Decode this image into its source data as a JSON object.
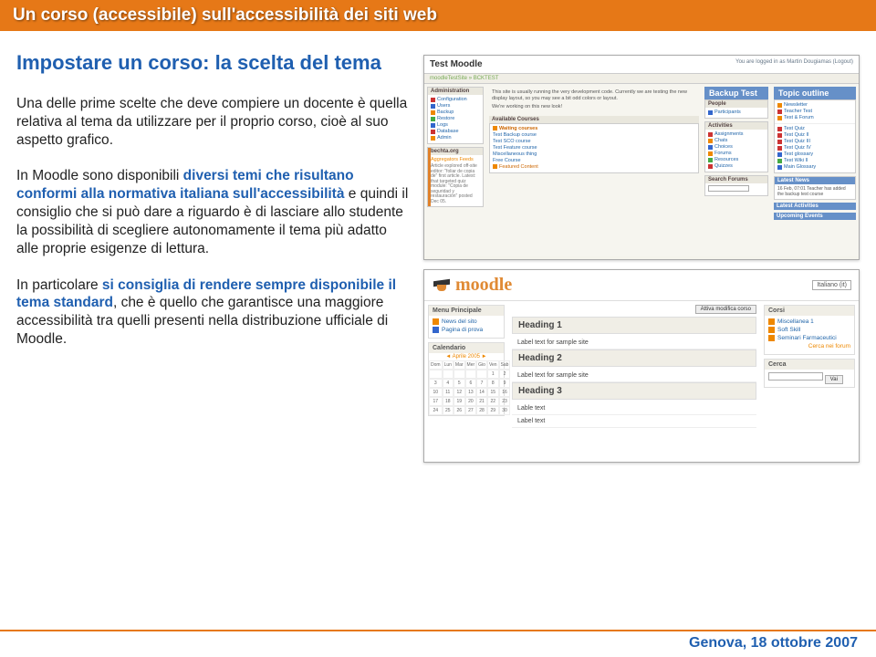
{
  "header": {
    "title": "Un corso (accessibile) sull'accessibilità dei siti web"
  },
  "slide": {
    "title": "Impostare un corso: la scelta del tema",
    "para1_pre": "Una delle prime scelte che deve compiere un docente è quella relativa al ",
    "para1_em1": "tema",
    "para1_mid": " da utilizzare per il proprio corso, cioè al suo ",
    "para1_em2": "aspetto grafico",
    "para1_end": ".",
    "para2_pre": "In Moodle sono disponibili ",
    "para2_b1": "diversi temi che risultano conformi alla normativa italiana sull'accessibilità",
    "para2_mid": " e quindi il consiglio che si può dare a riguardo è di lasciare allo studente la possibilità di scegliere autonomamente il tema più adatto alle proprie esigenze di lettura.",
    "para3_pre": "In particolare ",
    "para3_b1": "si consiglia di rendere sempre disponibile il tema standard",
    "para3_mid": ", che è quello che garantisce una maggiore accessibilità tra quelli presenti nella distribuzione ufficiale di Moodle."
  },
  "screenshots": {
    "top": {
      "title": "Test Moodle",
      "crumb": "moodleTestSite » BCKTEST",
      "admin_header": "Administration",
      "admin_items": [
        "Configuration",
        "Users",
        "Backup",
        "Restore",
        "Logs",
        "Database",
        "Admin"
      ],
      "bottom_left_header": "bechta.org",
      "bottom_left_sub": "Aggregators Feeds",
      "mid_text": "This site is usually running the very development code. Currently we are testing the new display layout, so you may see a bit odd colors or layout.",
      "mid_text2": "We're working on this new look!",
      "courses_header": "Available Courses",
      "waiting": "Waiting courses",
      "course_items": [
        "Test Backup course",
        "Test SCO course",
        "Test Feature course",
        "Miscellaneous thing",
        "Free Course",
        "Featured Content"
      ],
      "right_col1_header": "Backup Test",
      "people": "People",
      "people_item": "Participants",
      "activities": "Activities",
      "activity_items": [
        "Assignments",
        "Chats",
        "Choices",
        "Forums",
        "Resources",
        "Quizzes"
      ],
      "search": "Search Forums",
      "topic_header": "Topic outline",
      "topic_items": [
        "Newsletter",
        "Teacher Test",
        "Test & Forum"
      ],
      "topic_items2": [
        "Test Quiz",
        "Test Quiz II",
        "Test Quiz III",
        "Test Quiz IV",
        "Test glossary",
        "Test Wiki II",
        "Main Glossary"
      ],
      "latest": "Latest News",
      "latest_item": "16 Feb, 07:01 Teacher has added the backup test course",
      "latest2": "Latest Activities",
      "upcoming": "Upcoming Events",
      "login": "You are logged in as Martin Dougiamas (Logout)"
    },
    "bottom": {
      "logo": "moodle",
      "lang": "Italiano (it)",
      "menu_header": "Menu Principale",
      "menu_items": [
        "News del sito",
        "Pagina di prova"
      ],
      "cal_header": "Calendario",
      "cal_month": "Aprile 2005",
      "cal_dow": [
        "Dom",
        "Lun",
        "Mar",
        "Mer",
        "Gio",
        "Ven",
        "Sab"
      ],
      "heading1": "Heading 1",
      "heading2": "Heading 2",
      "heading3": "Heading 3",
      "label1": "Label text for sample site",
      "label2": "Label text for sample site",
      "label3": "Lable text",
      "label4": "Label text",
      "right_edit": "Attiva modifica corso",
      "corsi_header": "Corsi",
      "corsi_items": [
        "Miscellanea 1",
        "Soft Skill",
        "Seminari Farmaceutici"
      ],
      "corsi_link": "Cerca nei forum",
      "cerca_header": "Cerca",
      "cerca_btn": "Vai"
    }
  },
  "footer": {
    "text": "Genova, 18 ottobre 2007"
  }
}
